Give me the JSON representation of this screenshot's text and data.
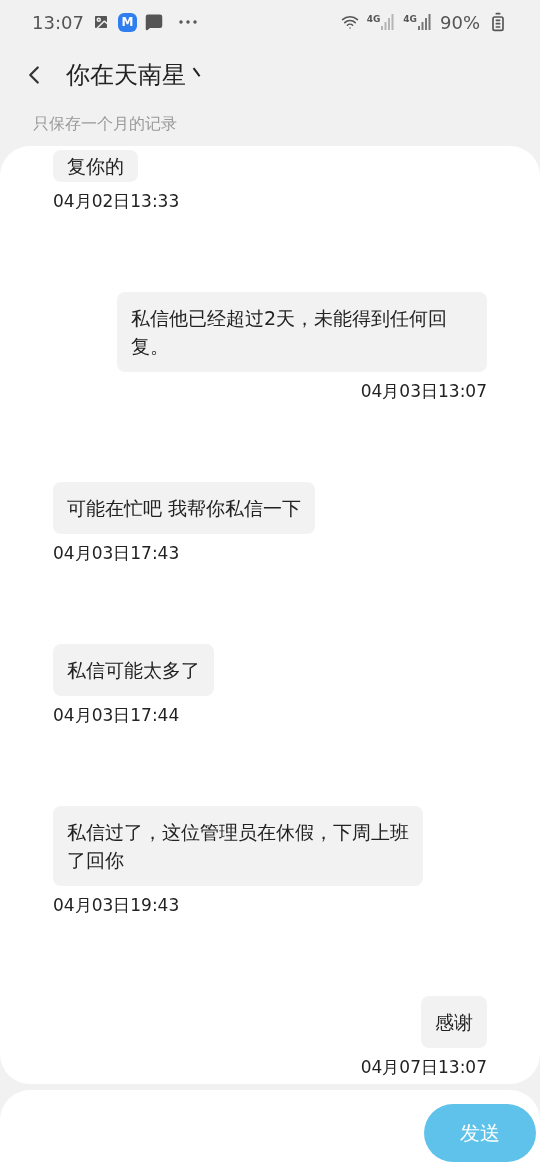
{
  "status_bar": {
    "time": "13:07",
    "app_badge": "M",
    "network_labels": [
      "4G",
      "4G"
    ],
    "battery": "90%"
  },
  "header": {
    "title": "你在天南星丶"
  },
  "notice": "只保存一个月的记录",
  "messages": [
    {
      "kind": "incoming",
      "text": "复你的",
      "time": "04月02日13:33"
    },
    {
      "kind": "outgoing",
      "text": "私信他已经超过2天，未能得到任何回复。",
      "time": "04月03日13:07"
    },
    {
      "kind": "incoming",
      "text": "可能在忙吧  我帮你私信一下",
      "time": "04月03日17:43"
    },
    {
      "kind": "incoming",
      "text": "私信可能太多了",
      "time": "04月03日17:44"
    },
    {
      "kind": "incoming",
      "text": "私信过了，这位管理员在休假，下周上班了回你",
      "time": "04月03日19:43"
    },
    {
      "kind": "outgoing",
      "text": "感谢",
      "time": "04月07日13:07"
    }
  ],
  "composer": {
    "send_label": "发送"
  }
}
